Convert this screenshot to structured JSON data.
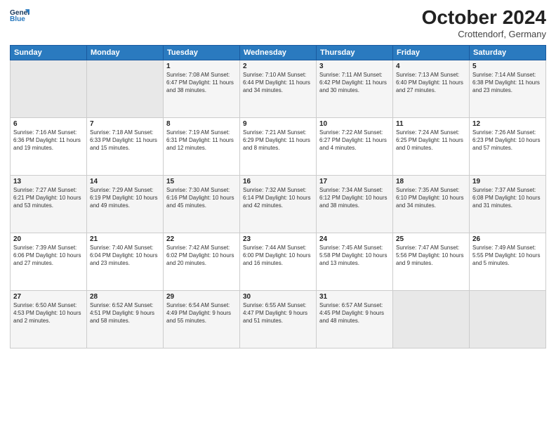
{
  "header": {
    "logo_line1": "General",
    "logo_line2": "Blue",
    "month": "October 2024",
    "location": "Crottendorf, Germany"
  },
  "weekdays": [
    "Sunday",
    "Monday",
    "Tuesday",
    "Wednesday",
    "Thursday",
    "Friday",
    "Saturday"
  ],
  "weeks": [
    [
      {
        "day": "",
        "info": ""
      },
      {
        "day": "",
        "info": ""
      },
      {
        "day": "1",
        "info": "Sunrise: 7:08 AM\nSunset: 6:47 PM\nDaylight: 11 hours and 38 minutes."
      },
      {
        "day": "2",
        "info": "Sunrise: 7:10 AM\nSunset: 6:44 PM\nDaylight: 11 hours and 34 minutes."
      },
      {
        "day": "3",
        "info": "Sunrise: 7:11 AM\nSunset: 6:42 PM\nDaylight: 11 hours and 30 minutes."
      },
      {
        "day": "4",
        "info": "Sunrise: 7:13 AM\nSunset: 6:40 PM\nDaylight: 11 hours and 27 minutes."
      },
      {
        "day": "5",
        "info": "Sunrise: 7:14 AM\nSunset: 6:38 PM\nDaylight: 11 hours and 23 minutes."
      }
    ],
    [
      {
        "day": "6",
        "info": "Sunrise: 7:16 AM\nSunset: 6:36 PM\nDaylight: 11 hours and 19 minutes."
      },
      {
        "day": "7",
        "info": "Sunrise: 7:18 AM\nSunset: 6:33 PM\nDaylight: 11 hours and 15 minutes."
      },
      {
        "day": "8",
        "info": "Sunrise: 7:19 AM\nSunset: 6:31 PM\nDaylight: 11 hours and 12 minutes."
      },
      {
        "day": "9",
        "info": "Sunrise: 7:21 AM\nSunset: 6:29 PM\nDaylight: 11 hours and 8 minutes."
      },
      {
        "day": "10",
        "info": "Sunrise: 7:22 AM\nSunset: 6:27 PM\nDaylight: 11 hours and 4 minutes."
      },
      {
        "day": "11",
        "info": "Sunrise: 7:24 AM\nSunset: 6:25 PM\nDaylight: 11 hours and 0 minutes."
      },
      {
        "day": "12",
        "info": "Sunrise: 7:26 AM\nSunset: 6:23 PM\nDaylight: 10 hours and 57 minutes."
      }
    ],
    [
      {
        "day": "13",
        "info": "Sunrise: 7:27 AM\nSunset: 6:21 PM\nDaylight: 10 hours and 53 minutes."
      },
      {
        "day": "14",
        "info": "Sunrise: 7:29 AM\nSunset: 6:19 PM\nDaylight: 10 hours and 49 minutes."
      },
      {
        "day": "15",
        "info": "Sunrise: 7:30 AM\nSunset: 6:16 PM\nDaylight: 10 hours and 45 minutes."
      },
      {
        "day": "16",
        "info": "Sunrise: 7:32 AM\nSunset: 6:14 PM\nDaylight: 10 hours and 42 minutes."
      },
      {
        "day": "17",
        "info": "Sunrise: 7:34 AM\nSunset: 6:12 PM\nDaylight: 10 hours and 38 minutes."
      },
      {
        "day": "18",
        "info": "Sunrise: 7:35 AM\nSunset: 6:10 PM\nDaylight: 10 hours and 34 minutes."
      },
      {
        "day": "19",
        "info": "Sunrise: 7:37 AM\nSunset: 6:08 PM\nDaylight: 10 hours and 31 minutes."
      }
    ],
    [
      {
        "day": "20",
        "info": "Sunrise: 7:39 AM\nSunset: 6:06 PM\nDaylight: 10 hours and 27 minutes."
      },
      {
        "day": "21",
        "info": "Sunrise: 7:40 AM\nSunset: 6:04 PM\nDaylight: 10 hours and 23 minutes."
      },
      {
        "day": "22",
        "info": "Sunrise: 7:42 AM\nSunset: 6:02 PM\nDaylight: 10 hours and 20 minutes."
      },
      {
        "day": "23",
        "info": "Sunrise: 7:44 AM\nSunset: 6:00 PM\nDaylight: 10 hours and 16 minutes."
      },
      {
        "day": "24",
        "info": "Sunrise: 7:45 AM\nSunset: 5:58 PM\nDaylight: 10 hours and 13 minutes."
      },
      {
        "day": "25",
        "info": "Sunrise: 7:47 AM\nSunset: 5:56 PM\nDaylight: 10 hours and 9 minutes."
      },
      {
        "day": "26",
        "info": "Sunrise: 7:49 AM\nSunset: 5:55 PM\nDaylight: 10 hours and 5 minutes."
      }
    ],
    [
      {
        "day": "27",
        "info": "Sunrise: 6:50 AM\nSunset: 4:53 PM\nDaylight: 10 hours and 2 minutes."
      },
      {
        "day": "28",
        "info": "Sunrise: 6:52 AM\nSunset: 4:51 PM\nDaylight: 9 hours and 58 minutes."
      },
      {
        "day": "29",
        "info": "Sunrise: 6:54 AM\nSunset: 4:49 PM\nDaylight: 9 hours and 55 minutes."
      },
      {
        "day": "30",
        "info": "Sunrise: 6:55 AM\nSunset: 4:47 PM\nDaylight: 9 hours and 51 minutes."
      },
      {
        "day": "31",
        "info": "Sunrise: 6:57 AM\nSunset: 4:45 PM\nDaylight: 9 hours and 48 minutes."
      },
      {
        "day": "",
        "info": ""
      },
      {
        "day": "",
        "info": ""
      }
    ]
  ]
}
